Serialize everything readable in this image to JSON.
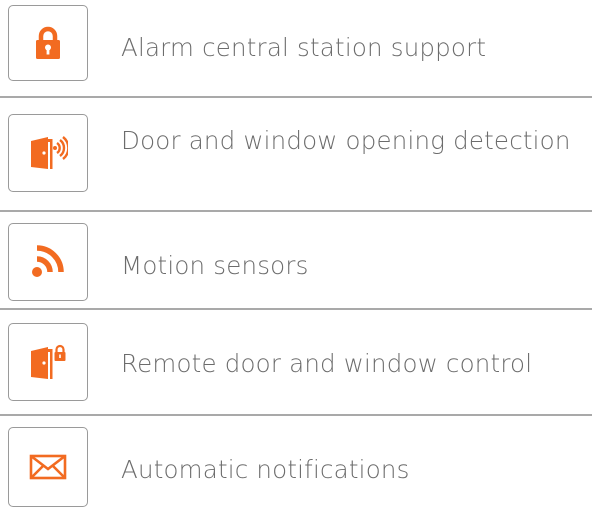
{
  "accent_color": "#f26b21",
  "features": [
    {
      "icon": "padlock-icon",
      "label": "Alarm central station support"
    },
    {
      "icon": "door-sensor-icon",
      "label": "Door and window opening detection"
    },
    {
      "icon": "motion-waves-icon",
      "label": "Motion sensors"
    },
    {
      "icon": "door-lock-icon",
      "label": "Remote door and window control"
    },
    {
      "icon": "envelope-icon",
      "label": "Automatic notifications"
    }
  ]
}
